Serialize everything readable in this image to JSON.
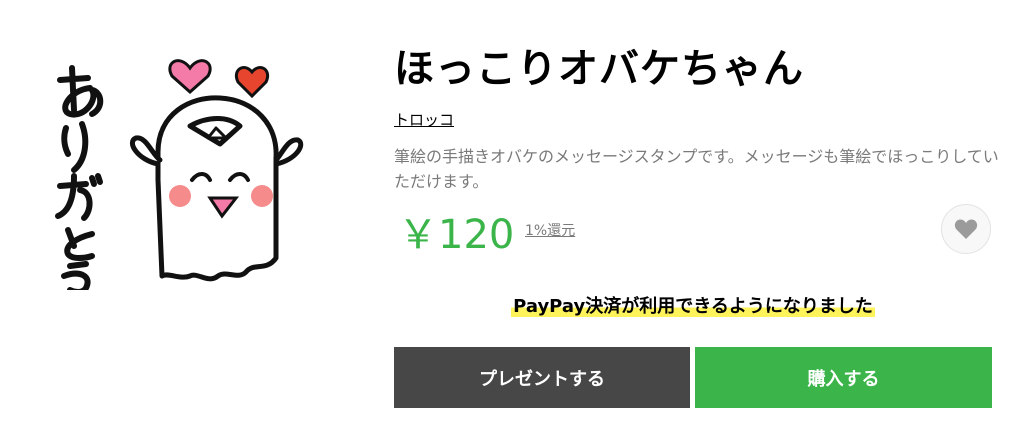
{
  "product": {
    "title": "ほっこりオバケちゃん",
    "author": "トロッコ",
    "description": "筆絵の手描きオバケのメッセージスタンプです。メッセージも筆絵でほっこりしていただけます。",
    "price": "￥120",
    "reward": "1%還元",
    "favorite_icon": "heart-icon"
  },
  "stamp": {
    "text": "ありがとう",
    "heart_pink": "#f47aa7",
    "heart_red": "#e8452f",
    "cheek_color": "#f58b8b"
  },
  "notice": {
    "text": "PayPay決済が利用できるようになりました",
    "highlight": "#fff35c"
  },
  "buttons": {
    "gift_label": "プレゼントする",
    "buy_label": "購入する"
  },
  "colors": {
    "accent_green": "#3bb54a",
    "dark_button": "#474747",
    "muted_text": "#7a7a7a"
  }
}
